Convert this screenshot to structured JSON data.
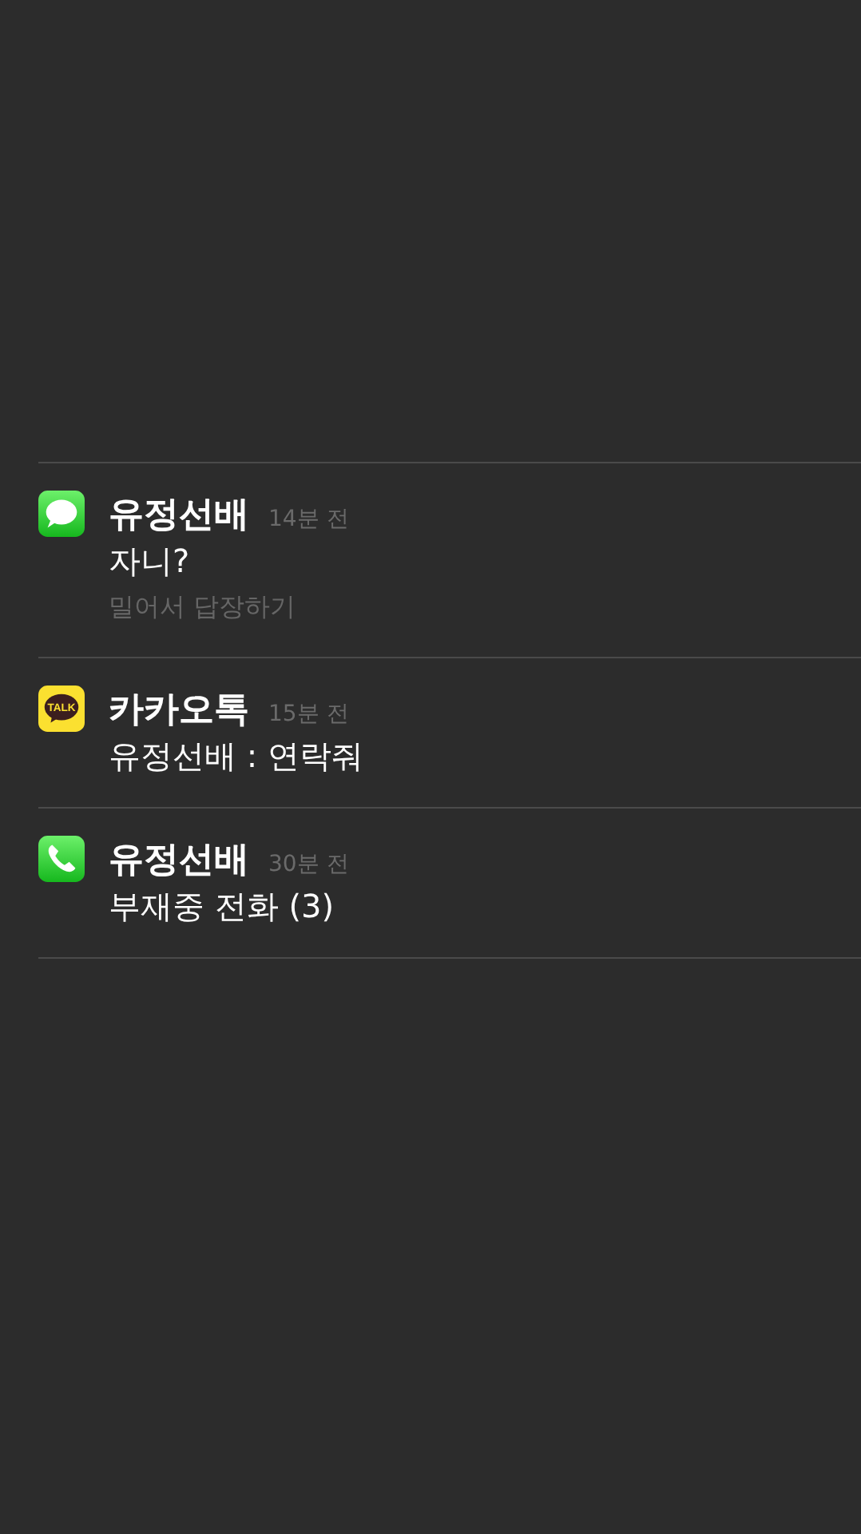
{
  "notifications": [
    {
      "kind": "messages",
      "title": "유정선배",
      "time": "14분 전",
      "body": "자니?",
      "hint": "밀어서 답장하기"
    },
    {
      "kind": "talk",
      "icon_text": "TALK",
      "title": "카카오톡",
      "time": "15분 전",
      "body": "유정선배 : 연락줘"
    },
    {
      "kind": "phone",
      "title": "유정선배",
      "time": "30분 전",
      "body": "부재중 전화 (3)"
    }
  ]
}
